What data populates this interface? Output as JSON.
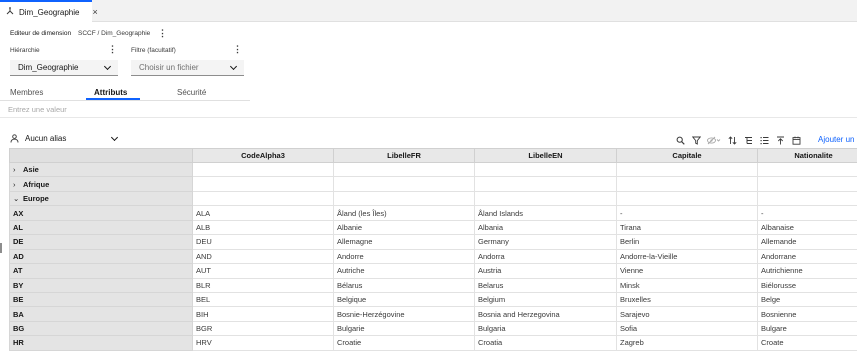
{
  "tab": {
    "title": "Dim_Geographie",
    "close": "×"
  },
  "editor": {
    "label": "Editeur de dimension",
    "path": "SCCF / Dim_Geographie"
  },
  "hierarchy": {
    "label": "Hiérarchie",
    "value": "Dim_Geographie"
  },
  "filter": {
    "label": "Filtre (facultatif)",
    "placeholder": "Choisir un fichier"
  },
  "tabs": {
    "members": "Membres",
    "attributes": "Attributs",
    "security": "Sécurité"
  },
  "search": {
    "placeholder": "Entrez une valeur"
  },
  "alias": {
    "label": "Aucun alias"
  },
  "toolbar": {
    "add_label": "Ajouter un a"
  },
  "icons": [
    "dimension-icon",
    "close-icon",
    "kebab-icon",
    "chevron-down-icon",
    "person-icon",
    "search-icon",
    "filter-icon",
    "hide-icon",
    "sort-icon",
    "tree-icon",
    "list-icon",
    "collapse-icon",
    "calendar-icon"
  ],
  "grid": {
    "columns": [
      "CodeAlpha3",
      "LibelleFR",
      "LibelleEN",
      "Capitale",
      "Nationalite"
    ],
    "groups": [
      {
        "label": "Asie",
        "expander": "›"
      },
      {
        "label": "Afrique",
        "expander": "›"
      },
      {
        "label": "Europe",
        "expander": "⌄"
      }
    ],
    "rows": [
      {
        "code": "AX",
        "cells": [
          "ALA",
          "Åland (les Îles)",
          "Åland Islands",
          "-",
          "-"
        ]
      },
      {
        "code": "AL",
        "cells": [
          "ALB",
          "Albanie",
          "Albania",
          "Tirana",
          "Albanaise"
        ]
      },
      {
        "code": "DE",
        "cells": [
          "DEU",
          "Allemagne",
          "Germany",
          "Berlin",
          "Allemande"
        ]
      },
      {
        "code": "AD",
        "cells": [
          "AND",
          "Andorre",
          "Andorra",
          "Andorre-la-Vieille",
          "Andorrane"
        ]
      },
      {
        "code": "AT",
        "cells": [
          "AUT",
          "Autriche",
          "Austria",
          "Vienne",
          "Autrichienne"
        ]
      },
      {
        "code": "BY",
        "cells": [
          "BLR",
          "Bélarus",
          "Belarus",
          "Minsk",
          "Biélorusse"
        ]
      },
      {
        "code": "BE",
        "cells": [
          "BEL",
          "Belgique",
          "Belgium",
          "Bruxelles",
          "Belge"
        ]
      },
      {
        "code": "BA",
        "cells": [
          "BIH",
          "Bosnie-Herzégovine",
          "Bosnia and Herzegovina",
          "Sarajevo",
          "Bosnienne"
        ]
      },
      {
        "code": "BG",
        "cells": [
          "BGR",
          "Bulgarie",
          "Bulgaria",
          "Sofia",
          "Bulgare"
        ]
      },
      {
        "code": "HR",
        "cells": [
          "HRV",
          "Croatie",
          "Croatia",
          "Zagreb",
          "Croate"
        ]
      }
    ]
  }
}
